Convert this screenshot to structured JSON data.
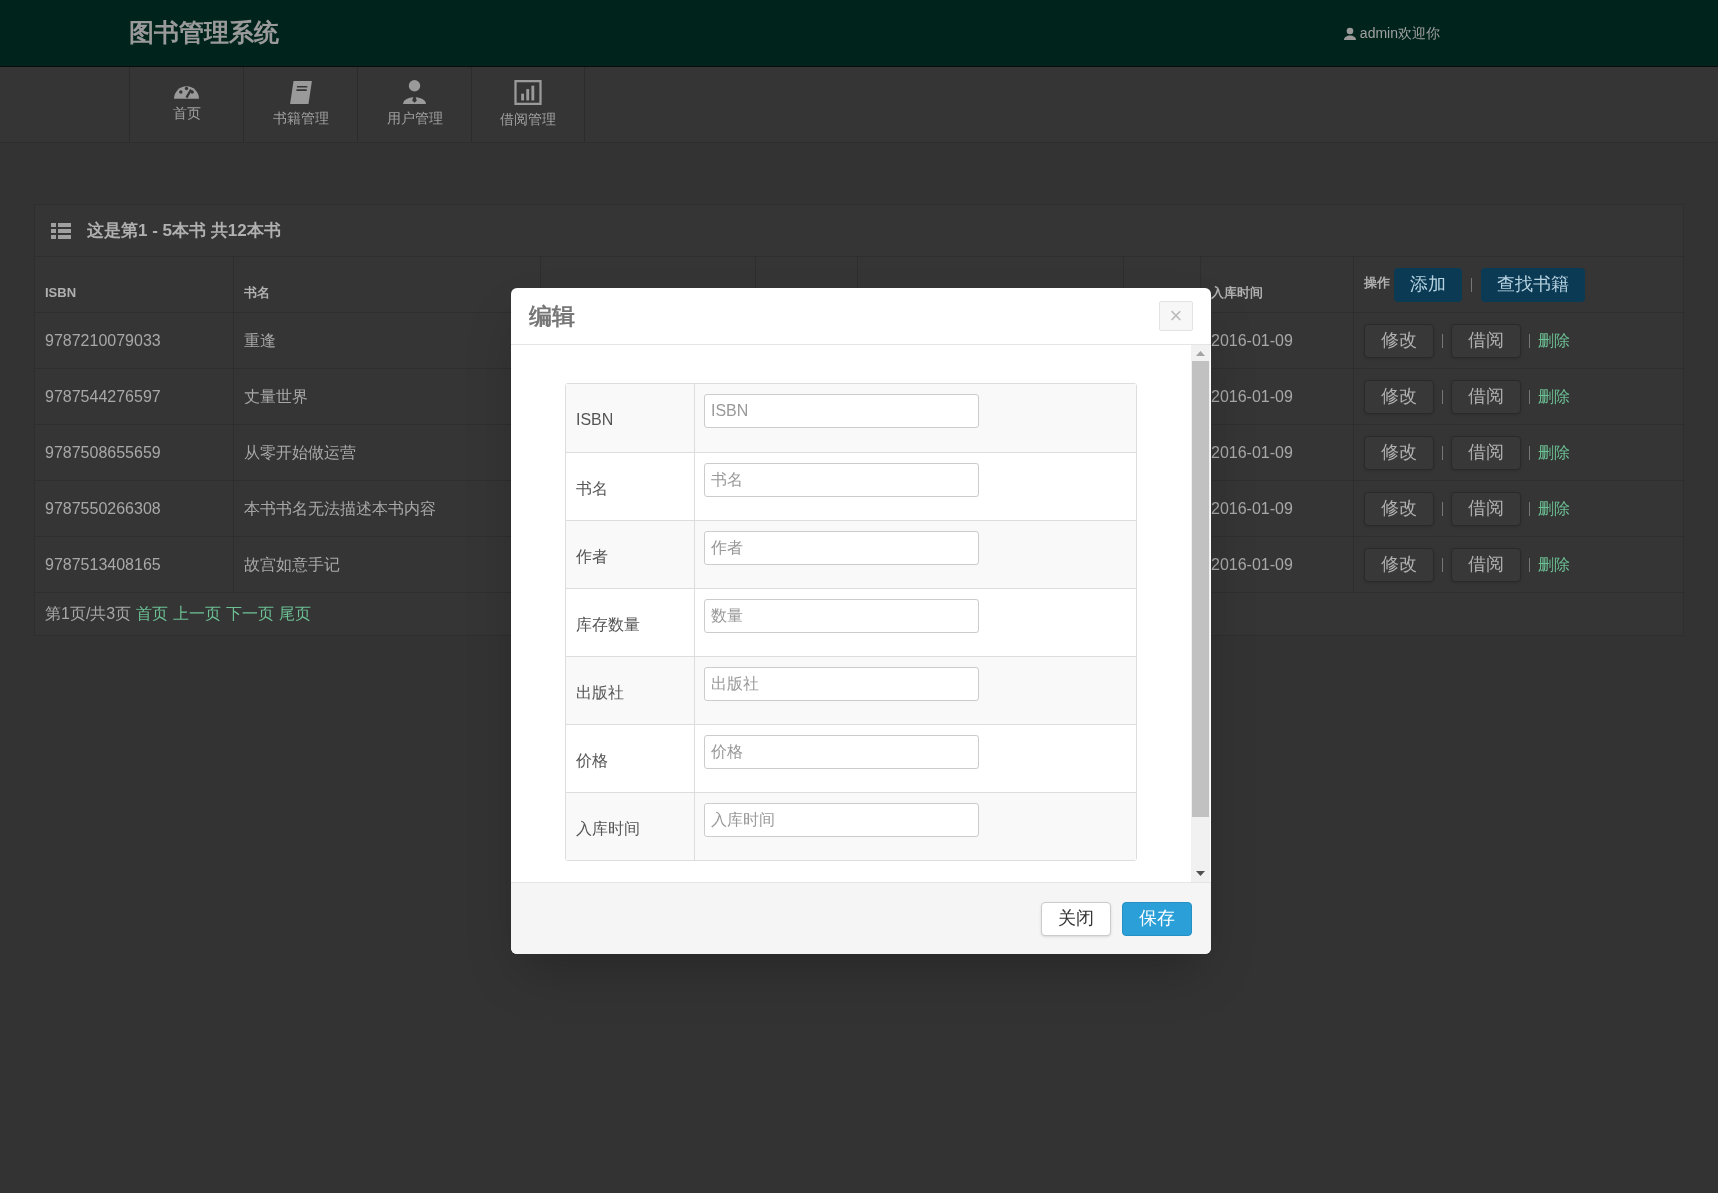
{
  "header": {
    "title": "图书管理系统",
    "user": "admin欢迎你"
  },
  "nav": [
    {
      "label": "首页",
      "kind": "dashboard"
    },
    {
      "label": "书籍管理",
      "kind": "book"
    },
    {
      "label": "用户管理",
      "kind": "user"
    },
    {
      "label": "借阅管理",
      "kind": "chart"
    }
  ],
  "panel": {
    "heading": "这是第1 - 5本书 共12本书",
    "columns": {
      "isbn": "ISBN",
      "title": "书名",
      "date": "入库时间",
      "actions": "操作"
    },
    "toolbar": [
      "添加",
      "查找书籍"
    ],
    "rows": [
      {
        "isbn": "9787210079033",
        "title": "重逢",
        "date": "2016-01-09",
        "actions": [
          "修改",
          "借阅",
          "删除"
        ]
      },
      {
        "isbn": "9787544276597",
        "title": "丈量世界",
        "date": "2016-01-09",
        "actions": [
          "修改",
          "借阅",
          "删除"
        ]
      },
      {
        "isbn": "9787508655659",
        "title": "从零开始做运营",
        "date": "2016-01-09",
        "actions": [
          "修改",
          "借阅",
          "删除"
        ]
      },
      {
        "isbn": "9787550266308",
        "title": "本书书名无法描述本书内容",
        "date": "2016-01-09",
        "actions": [
          "修改",
          "借阅",
          "删除"
        ]
      },
      {
        "isbn": "9787513408165",
        "title": "故宫如意手记",
        "date": "2016-01-09",
        "actions": [
          "修改",
          "借阅",
          "删除"
        ]
      }
    ],
    "pagination": {
      "info": "第1页/共3页",
      "links": [
        "首页",
        "上一页",
        "下一页",
        "尾页"
      ]
    }
  },
  "modal": {
    "title": "编辑",
    "close": "×",
    "fields": [
      {
        "label": "ISBN",
        "placeholder": "ISBN"
      },
      {
        "label": "书名",
        "placeholder": "书名"
      },
      {
        "label": "作者",
        "placeholder": "作者"
      },
      {
        "label": "库存数量",
        "placeholder": "数量"
      },
      {
        "label": "出版社",
        "placeholder": "出版社"
      },
      {
        "label": "价格",
        "placeholder": "价格"
      },
      {
        "label": "入库时间",
        "placeholder": "入库时间"
      }
    ],
    "buttons": [
      {
        "label": "关闭",
        "kind": "default"
      },
      {
        "label": "保存",
        "kind": "primary"
      }
    ]
  }
}
